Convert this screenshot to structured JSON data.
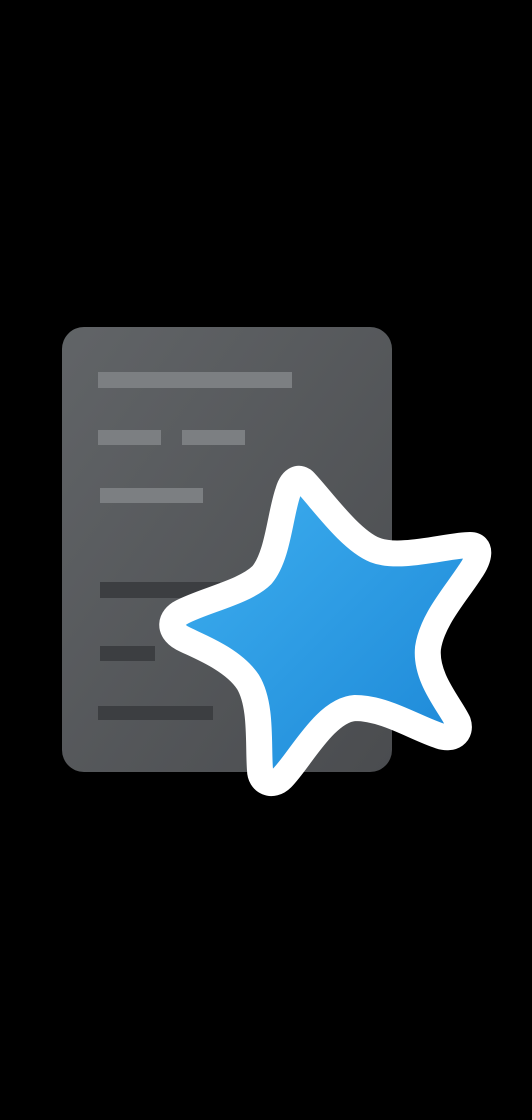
{
  "screen": {
    "type": "splash",
    "background_color": "#000000"
  },
  "logo": {
    "icon": "card-with-star-icon",
    "card_color": "#5a5d60",
    "card_line_color": "#7c7f82",
    "star_fill_color": "#2b9ee8",
    "star_outline_color": "#ffffff"
  }
}
